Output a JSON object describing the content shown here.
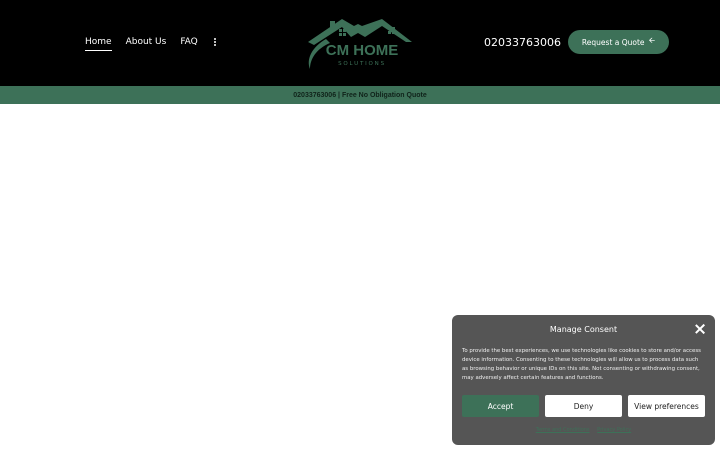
{
  "nav": {
    "items": [
      {
        "label": "Home",
        "active": true
      },
      {
        "label": "About Us",
        "active": false
      },
      {
        "label": "FAQ",
        "active": false
      }
    ],
    "more_icon": "vertical-ellipsis-icon"
  },
  "logo": {
    "brand": "CM HOME",
    "tagline": "SOLUTIONS",
    "icon": "house-roof-logo"
  },
  "header": {
    "phone": "02033763006",
    "quote_button": "Request a Quote",
    "quote_icon": "arrow-left-icon"
  },
  "topbar": {
    "text": "02033763006 | Free No Obligation Quote"
  },
  "consent": {
    "title": "Manage Consent",
    "body": "To provide the best experiences, we use technologies like cookies to store and/or access device information. Consenting to these technologies will allow us to process data such as browsing behavior or unique IDs on this site. Not consenting or withdrawing consent, may adversely affect certain features and functions.",
    "accept": "Accept",
    "deny": "Deny",
    "preferences": "View preferences",
    "terms_link": "Terms and Conditions",
    "privacy_link": "Privacy Policy",
    "close_icon": "close-icon"
  },
  "colors": {
    "brand_green": "#3d7158",
    "header_bg": "#000000",
    "modal_bg": "#555555"
  }
}
